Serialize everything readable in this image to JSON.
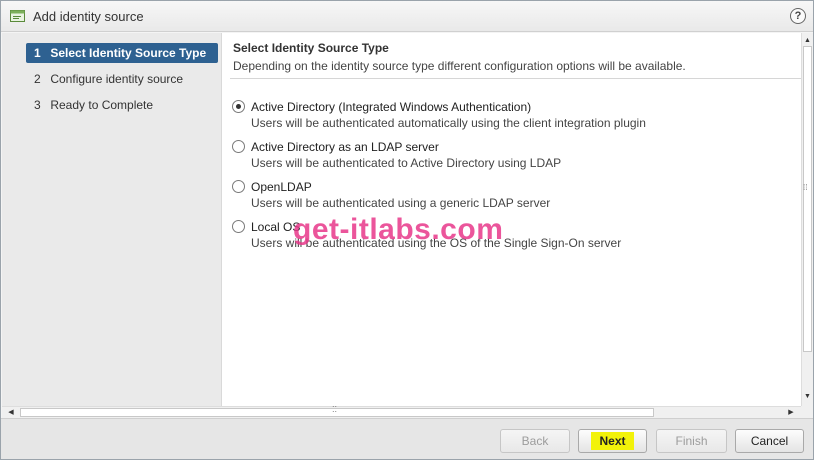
{
  "window": {
    "title": "Add identity source",
    "title_icon": "wizard-icon",
    "help_label": "?"
  },
  "steps": [
    {
      "num": "1",
      "label": "Select Identity Source Type",
      "active": true
    },
    {
      "num": "2",
      "label": "Configure identity source",
      "active": false
    },
    {
      "num": "3",
      "label": "Ready to Complete",
      "active": false
    }
  ],
  "content": {
    "title": "Select Identity Source Type",
    "description": "Depending on the identity source type different configuration options will be available.",
    "options": [
      {
        "label": "Active Directory (Integrated Windows Authentication)",
        "description": "Users will be authenticated automatically using the client integration plugin",
        "selected": true
      },
      {
        "label": "Active Directory as an LDAP server",
        "description": "Users will be authenticated to Active Directory using LDAP",
        "selected": false
      },
      {
        "label": "OpenLDAP",
        "description": "Users will be authenticated using a generic LDAP server",
        "selected": false
      },
      {
        "label": "Local OS",
        "description": "Users will be authenticated using the OS of the Single Sign-On server",
        "selected": false
      }
    ]
  },
  "watermark": "get-itlabs.com",
  "footer": {
    "back_label": "Back",
    "next_label": "Next",
    "finish_label": "Finish",
    "cancel_label": "Cancel"
  },
  "colors": {
    "active_step": "#2e6191",
    "next_highlight": "#f2f20a",
    "watermark": "#e8388a"
  }
}
